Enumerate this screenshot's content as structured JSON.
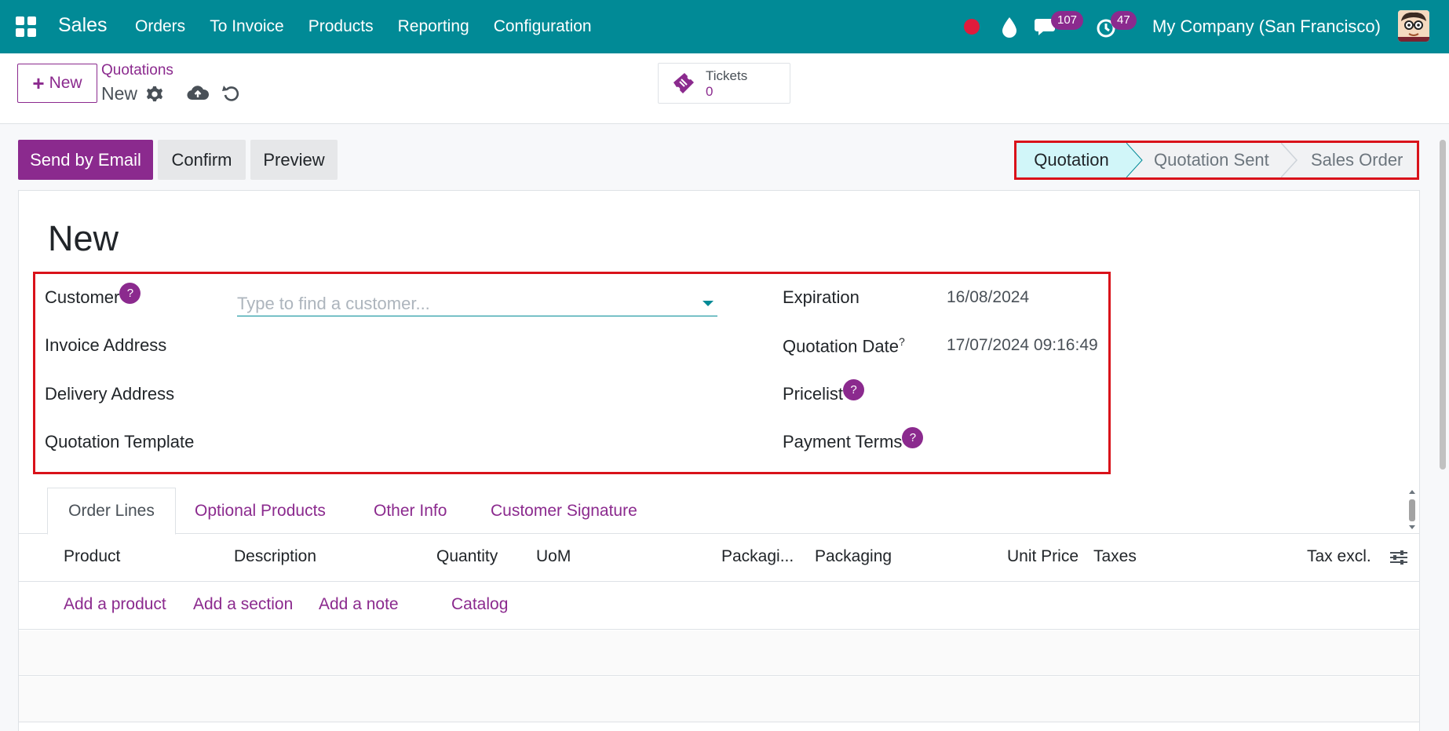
{
  "navbar": {
    "app_name": "Sales",
    "menu": [
      "Orders",
      "To Invoice",
      "Products",
      "Reporting",
      "Configuration"
    ],
    "messages_badge": "107",
    "activities_badge": "47",
    "company": "My Company (San Francisco)"
  },
  "control_panel": {
    "new_label": "New",
    "breadcrumb": "Quotations",
    "record_name": "New",
    "tickets_label": "Tickets",
    "tickets_count": "0"
  },
  "actions": {
    "send_email": "Send by Email",
    "confirm": "Confirm",
    "preview": "Preview"
  },
  "statusbar": {
    "steps": [
      "Quotation",
      "Quotation Sent",
      "Sales Order"
    ],
    "active": "Quotation"
  },
  "form": {
    "title": "New",
    "left": {
      "customer_label": "Customer",
      "customer_placeholder": "Type to find a customer...",
      "invoice_address_label": "Invoice Address",
      "delivery_address_label": "Delivery Address",
      "template_label": "Quotation Template"
    },
    "right": {
      "expiration_label": "Expiration",
      "expiration_value": "16/08/2024",
      "quotation_date_label": "Quotation Date",
      "quotation_date_value": "17/07/2024 09:16:49",
      "pricelist_label": "Pricelist",
      "payment_terms_label": "Payment Terms"
    },
    "help_mark": "?"
  },
  "tabs": [
    "Order Lines",
    "Optional Products",
    "Other Info",
    "Customer Signature"
  ],
  "table": {
    "columns": [
      "Product",
      "Description",
      "Quantity",
      "UoM",
      "Packagi...",
      "Packaging",
      "Unit Price",
      "Taxes",
      "Tax excl."
    ],
    "add_links": [
      "Add a product",
      "Add a section",
      "Add a note",
      "Catalog"
    ]
  },
  "colors": {
    "navbar": "#018a96",
    "brand": "#8b2a8e",
    "highlight": "#d9121a",
    "active_step": "#d1f6f9"
  }
}
